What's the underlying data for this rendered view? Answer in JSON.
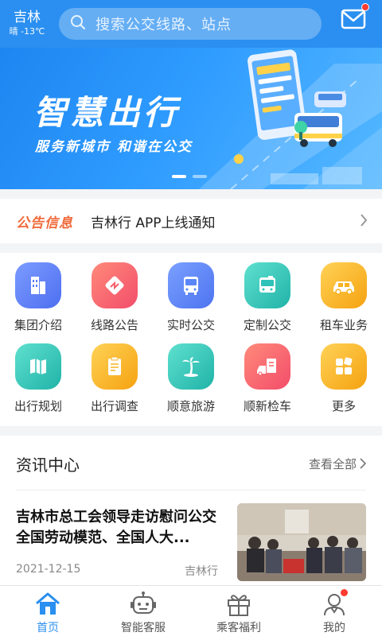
{
  "header": {
    "city": "吉林",
    "weather": "晴 -13℃",
    "search_placeholder": "搜索公交线路、站点"
  },
  "banner": {
    "title": "智慧出行",
    "subtitle": "服务新城市 和谐在公交",
    "active_slide": 1,
    "slide_count": 2
  },
  "notice": {
    "tag": "公告信息",
    "text": "吉林行 APP上线通知"
  },
  "services": [
    {
      "label": "集团介绍",
      "icon": "buildings-icon",
      "color": "#5b7cf6"
    },
    {
      "label": "线路公告",
      "icon": "route-sign-icon",
      "color": "#f7606a"
    },
    {
      "label": "实时公交",
      "icon": "bus-icon",
      "color": "#5b86f7"
    },
    {
      "label": "定制公交",
      "icon": "custom-bus-icon",
      "color": "#2fc2b8"
    },
    {
      "label": "租车业务",
      "icon": "car-icon",
      "color": "#f7b21f"
    },
    {
      "label": "出行规划",
      "icon": "map-icon",
      "color": "#2fc2b8"
    },
    {
      "label": "出行调查",
      "icon": "clipboard-icon",
      "color": "#f7b21f"
    },
    {
      "label": "顺意旅游",
      "icon": "palm-tree-icon",
      "color": "#2fc2b8"
    },
    {
      "label": "顺新检车",
      "icon": "car-inspection-icon",
      "color": "#f7606a"
    },
    {
      "label": "更多",
      "icon": "more-grid-icon",
      "color": "#f7b21f"
    }
  ],
  "news": {
    "section_title": "资讯中心",
    "view_all": "查看全部",
    "article": {
      "title": "吉林市总工会领导走访慰问公交全国劳动模范、全国人大...",
      "date": "2021-12-15",
      "source": "吉林行"
    }
  },
  "tabbar": [
    {
      "label": "首页",
      "icon": "home-icon",
      "active": true
    },
    {
      "label": "智能客服",
      "icon": "robot-icon",
      "active": false
    },
    {
      "label": "乘客福利",
      "icon": "gift-icon",
      "active": false
    },
    {
      "label": "我的",
      "icon": "user-icon",
      "active": false,
      "badge": true
    }
  ],
  "colors": {
    "primary": "#2a8ff0",
    "notice_tag": "#f06a3a",
    "badge": "#ff3b30"
  }
}
